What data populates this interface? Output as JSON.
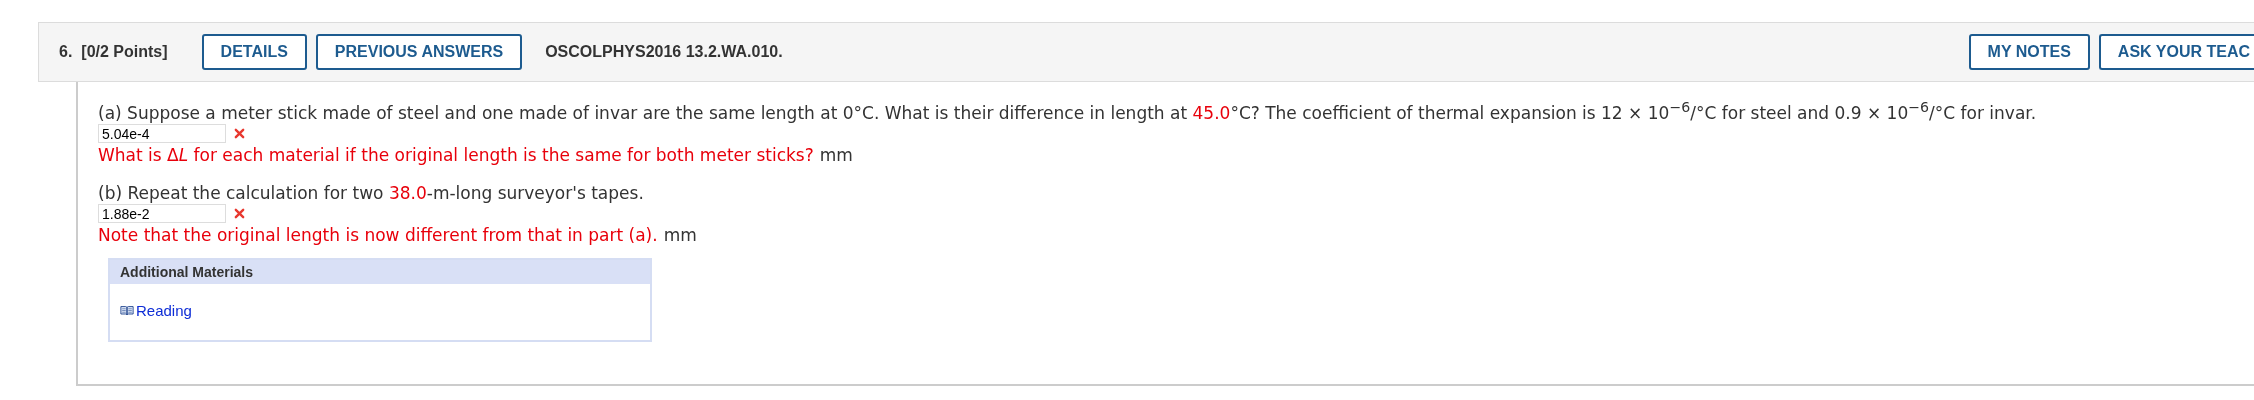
{
  "question": {
    "number": "6.",
    "points": "[0/2 Points]",
    "buttons": [
      {
        "label": "DETAILS"
      },
      {
        "label": "PREVIOUS ANSWERS"
      }
    ],
    "code": "OSCOLPHYS2016 13.2.WA.010.",
    "right_buttons": [
      {
        "label": "MY NOTES"
      },
      {
        "label": "ASK YOUR TEAC"
      }
    ]
  },
  "parts": [
    {
      "prompt": [
        {
          "kind": "text",
          "text": "(a) Suppose a meter stick made of steel and one made of invar are the same length at 0°C. What is their difference in length at "
        },
        {
          "kind": "value",
          "text": "45.0"
        },
        {
          "kind": "text",
          "text": "°C? The coefficient of thermal expansion is 12 × 10$^{−6}$/°C for steel and 0.9 × 10$^{−6}$/°C for invar."
        }
      ],
      "answer": "5.04e-4",
      "correct": false,
      "feedback": [
        {
          "kind": "text",
          "text": "What is Δ"
        },
        {
          "kind": "italic",
          "text": "L"
        },
        {
          "kind": "text",
          "text": " for each material if the original length is the same for both meter sticks?"
        }
      ],
      "unit": "mm"
    },
    {
      "prompt": [
        {
          "kind": "text",
          "text": "(b) Repeat the calculation for two "
        },
        {
          "kind": "value",
          "text": "38.0"
        },
        {
          "kind": "text",
          "text": "-m-long surveyor's tapes."
        }
      ],
      "answer": "1.88e-2",
      "correct": false,
      "feedback": [
        {
          "kind": "text",
          "text": "Note that the original length is now different from that in part (a)."
        }
      ],
      "unit": "mm"
    }
  ],
  "additional_materials": {
    "title": "Additional Materials",
    "links": [
      {
        "label": "Reading"
      }
    ]
  }
}
